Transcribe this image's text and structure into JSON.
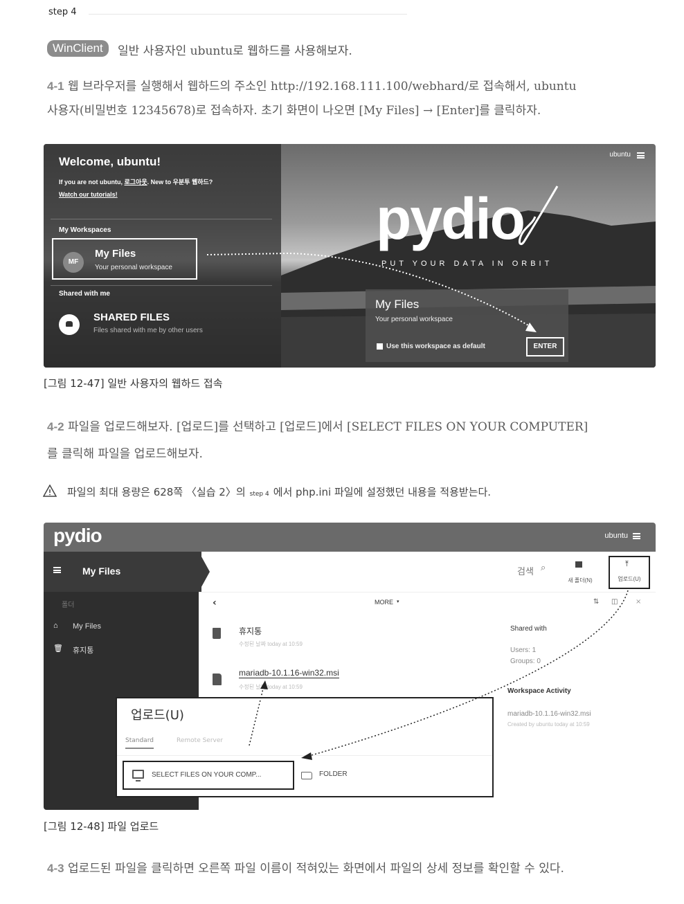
{
  "step_label": "step 4",
  "intro": {
    "badge": "WinClient",
    "text": "일반 사용자인 ubuntu로 웹하드를 사용해보자."
  },
  "p41": {
    "num": "4-1",
    "line1": "웹 브라우저를 실행해서 웹하드의 주소인 http://192.168.111.100/webhard/로 접속해서, ubuntu",
    "line2": "사용자(비밀번호 12345678)로 접속하자. 초기 화면이 나오면 [My Files] → [Enter]를 클릭하자."
  },
  "fig1": {
    "welcome": "Welcome, ubuntu!",
    "not_user_prefix": "If you are not ubuntu, ",
    "logout_link": "로그아웃",
    "not_user_suffix": ". New to 우분투 웹하드?",
    "tutorials": "Watch our tutorials!",
    "my_workspaces": "My Workspaces",
    "avatar": "MF",
    "myfiles_title": "My Files",
    "myfiles_sub": "Your personal workspace",
    "shared_with_me": "Shared with me",
    "shared_title": "SHARED FILES",
    "shared_sub": "Files shared with me by other users",
    "user": "ubuntu",
    "logo": "pydio",
    "tagline": "PUT YOUR DATA IN ORBIT",
    "card_title": "My Files",
    "card_sub": "Your personal workspace",
    "card_checkbox": "Use this workspace as default",
    "enter": "ENTER"
  },
  "caption1": "[그림 12-47] 일반 사용자의 웹하드 접속",
  "p42": {
    "num": "4-2",
    "line1": "파일을 업로드해보자. [업로드]를 선택하고 [업로드]에서 [SELECT FILES ON YOUR COMPUTER]",
    "line2": "를 클릭해 파일을 업로드해보자."
  },
  "warning": {
    "before": "파일의 최대 용량은 628쪽 〈실습 2〉의",
    "step": "step 4",
    "after": "에서 php.ini 파일에 설정했던 내용을 적용받는다."
  },
  "fig2": {
    "logo": "pydio",
    "user": "ubuntu",
    "title": "My Files",
    "search": "검색",
    "new_folder": "새 폴더(N)",
    "upload": "업로드(U)",
    "sidebar_section": "폴더",
    "sidebar_items": [
      "My Files",
      "휴지통"
    ],
    "more": "MORE",
    "files": [
      {
        "name": "휴지통",
        "meta": "수정된 날짜 today at 10:59"
      },
      {
        "name": "mariadb-10.1.16-win32.msi",
        "meta": "수정된 날짜 today at 10:59"
      }
    ],
    "shared_with": "Shared with",
    "users": "Users: 1",
    "groups": "Groups: 0",
    "activity": "Workspace Activity",
    "activity_file": "mariadb-10.1.16-win32.msi",
    "activity_meta": "Created by ubuntu today at 10:59",
    "dialog_title": "업로드(U)",
    "tab_standard": "Standard",
    "tab_remote": "Remote Server",
    "select_files": "SELECT FILES ON YOUR COMP...",
    "folder": "FOLDER"
  },
  "caption2": "[그림 12-48] 파일 업로드",
  "p43": {
    "num": "4-3",
    "line1": "업로드된 파일을 클릭하면 오른쪽 파일 이름이 적혀있는 화면에서 파일의 상세 정보를 확인할 수 있다."
  }
}
